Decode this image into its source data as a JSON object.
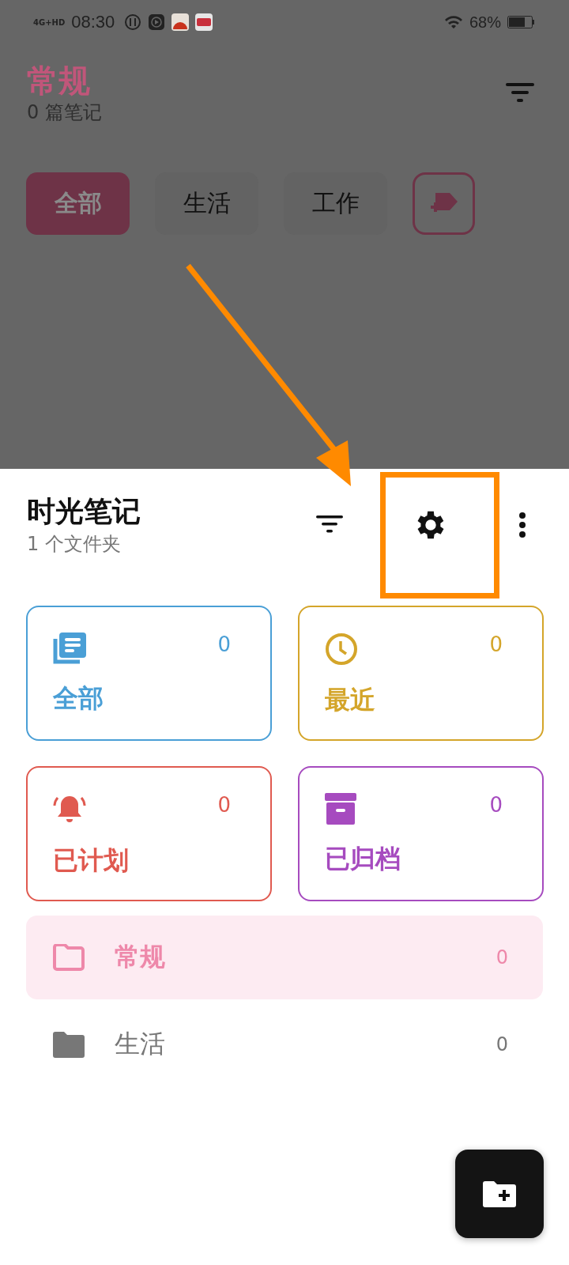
{
  "status_bar": {
    "network": "4G+HD",
    "time": "08:30",
    "battery_text": "68%"
  },
  "background_screen": {
    "title": "常规",
    "subtitle": "0 篇笔记",
    "chips": [
      {
        "label": "全部",
        "selected": true
      },
      {
        "label": "生活",
        "selected": false
      },
      {
        "label": "工作",
        "selected": false
      }
    ]
  },
  "sheet": {
    "title": "时光笔记",
    "subtitle": "1 个文件夹",
    "cards": [
      {
        "kind": "all",
        "label": "全部",
        "count": "0",
        "color": "#4a9fd6"
      },
      {
        "kind": "recent",
        "label": "最近",
        "count": "0",
        "color": "#d4a52a"
      },
      {
        "kind": "scheduled",
        "label": "已计划",
        "count": "0",
        "color": "#e05a50"
      },
      {
        "kind": "archived",
        "label": "已归档",
        "count": "0",
        "color": "#a64bbf"
      }
    ],
    "folders": [
      {
        "name": "常规",
        "count": "0",
        "selected": true
      },
      {
        "name": "生活",
        "count": "0",
        "selected": false
      }
    ]
  }
}
